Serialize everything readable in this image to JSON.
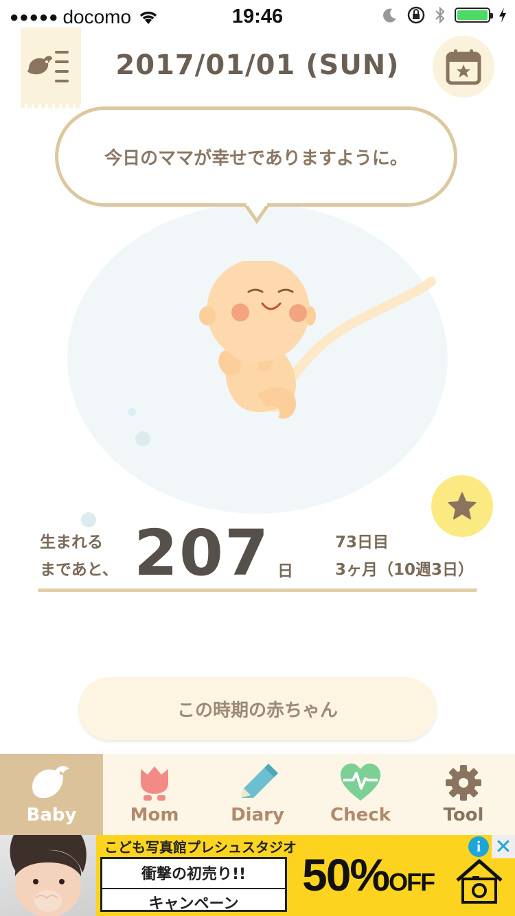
{
  "status_bar": {
    "signal": "●●●●●",
    "carrier": "docomo",
    "time": "19:46"
  },
  "header": {
    "date": "2017/01/01 (SUN)"
  },
  "message": "今日のママが幸せでありますように。",
  "countdown": {
    "label_line1": "生まれる",
    "label_line2": "まであと、",
    "days_left": "207",
    "unit": "日",
    "day_count": "73日目",
    "month_week": "3ヶ月（10週3日）"
  },
  "period_button": "この時期の赤ちゃん",
  "tabs": [
    {
      "label": "Baby",
      "icon": "bird-icon",
      "color": "#ffffff"
    },
    {
      "label": "Mom",
      "icon": "tulip-icon",
      "color": "#b08a6a"
    },
    {
      "label": "Diary",
      "icon": "pencil-icon",
      "color": "#b08a6a"
    },
    {
      "label": "Check",
      "icon": "heart-pulse-icon",
      "color": "#b08a6a"
    },
    {
      "label": "Tool",
      "icon": "gear-icon",
      "color": "#b08a6a"
    }
  ],
  "ad": {
    "headline": "こども写真館プレシュスタジオ",
    "line1": "衝撃の初売り!!",
    "line2": "キャンペーン",
    "offer_main": "50%",
    "offer_sub": "OFF",
    "info": "i",
    "close": "✕"
  },
  "colors": {
    "accent": "#dcc29b",
    "bubble_border": "#dcc79f",
    "star": "#fbe982",
    "ad_bg": "#fcd41f"
  }
}
